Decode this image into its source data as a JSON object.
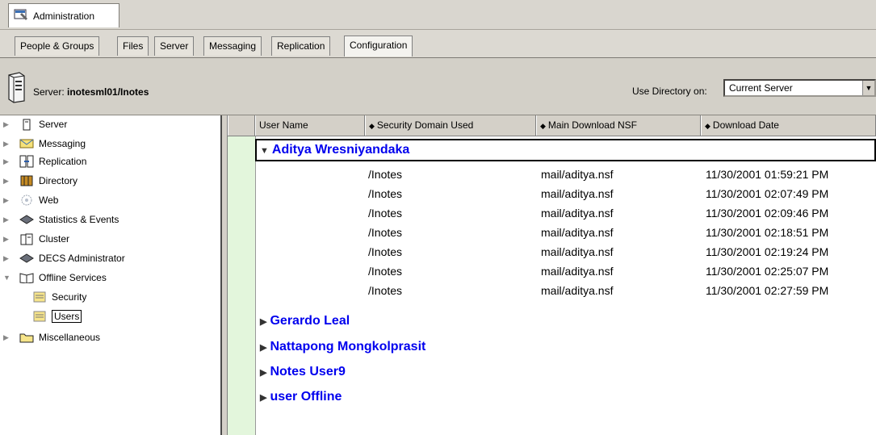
{
  "window_tab": {
    "label": "Administration"
  },
  "tabs": [
    {
      "label": "People & Groups",
      "active": false
    },
    {
      "label": "Files",
      "active": false
    },
    {
      "label": "Server",
      "active": false
    },
    {
      "label": "Messaging",
      "active": false
    },
    {
      "label": "Replication",
      "active": false
    },
    {
      "label": "Configuration",
      "active": true
    }
  ],
  "server": {
    "prefix": "Server: ",
    "name": "inotesml01/Inotes"
  },
  "directory": {
    "label": "Use Directory on:",
    "value": "Current Server"
  },
  "nav": {
    "items": [
      {
        "label": "Server",
        "icon": "server-icon",
        "expanded": false
      },
      {
        "label": "Messaging",
        "icon": "envelope-icon",
        "expanded": false
      },
      {
        "label": "Replication",
        "icon": "replication-icon",
        "expanded": false
      },
      {
        "label": "Directory",
        "icon": "directory-icon",
        "expanded": false
      },
      {
        "label": "Web",
        "icon": "web-icon",
        "expanded": false
      },
      {
        "label": "Statistics & Events",
        "icon": "statistics-icon",
        "expanded": false
      },
      {
        "label": "Cluster",
        "icon": "cluster-icon",
        "expanded": false
      },
      {
        "label": "DECS Administrator",
        "icon": "decs-icon",
        "expanded": false
      },
      {
        "label": "Offline Services",
        "icon": "book-icon",
        "expanded": true
      },
      {
        "label": "Miscellaneous",
        "icon": "folder-icon",
        "expanded": false
      }
    ],
    "children": [
      {
        "label": "Security",
        "icon": "view-icon"
      },
      {
        "label": "Users",
        "icon": "view-icon",
        "selected": true
      }
    ]
  },
  "columns": [
    {
      "label": "User Name"
    },
    {
      "label": "Security Domain Used"
    },
    {
      "label": "Main Download NSF"
    },
    {
      "label": "Download Date"
    }
  ],
  "groups": [
    {
      "name": "Aditya Wresniyandaka",
      "expanded": true,
      "rows": [
        {
          "domain": "/Inotes",
          "nsf": "mail/aditya.nsf",
          "date": "11/30/2001 01:59:21 PM"
        },
        {
          "domain": "/Inotes",
          "nsf": "mail/aditya.nsf",
          "date": "11/30/2001 02:07:49 PM"
        },
        {
          "domain": "/Inotes",
          "nsf": "mail/aditya.nsf",
          "date": "11/30/2001 02:09:46 PM"
        },
        {
          "domain": "/Inotes",
          "nsf": "mail/aditya.nsf",
          "date": "11/30/2001 02:18:51 PM"
        },
        {
          "domain": "/Inotes",
          "nsf": "mail/aditya.nsf",
          "date": "11/30/2001 02:19:24 PM"
        },
        {
          "domain": "/Inotes",
          "nsf": "mail/aditya.nsf",
          "date": "11/30/2001 02:25:07 PM"
        },
        {
          "domain": "/Inotes",
          "nsf": "mail/aditya.nsf",
          "date": "11/30/2001 02:27:59 PM"
        }
      ]
    },
    {
      "name": "Gerardo Leal",
      "expanded": false
    },
    {
      "name": "Nattapong Mongkolprasit",
      "expanded": false
    },
    {
      "name": "Notes User9",
      "expanded": false
    },
    {
      "name": "user Offline",
      "expanded": false
    }
  ]
}
